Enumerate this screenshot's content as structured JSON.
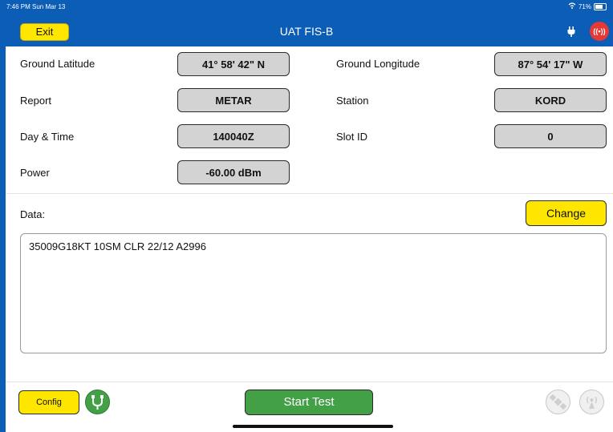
{
  "status_bar": {
    "time": "7:46 PM  Sun Mar 13",
    "battery": "71%"
  },
  "header": {
    "exit_label": "Exit",
    "title": "UAT FIS-B"
  },
  "fields": {
    "ground_latitude_label": "Ground Latitude",
    "ground_latitude_value": "41° 58' 42\" N",
    "ground_longitude_label": "Ground Longitude",
    "ground_longitude_value": "87° 54' 17\" W",
    "report_label": "Report",
    "report_value": "METAR",
    "station_label": "Station",
    "station_value": "KORD",
    "day_time_label": "Day & Time",
    "day_time_value": "140040Z",
    "slot_id_label": "Slot ID",
    "slot_id_value": "0",
    "power_label": "Power",
    "power_value": "-60.00 dBm"
  },
  "data_section": {
    "label": "Data:",
    "change_label": "Change",
    "text": "35009G18KT 10SM CLR 22/12 A2996"
  },
  "footer": {
    "config_label": "Config",
    "start_label": "Start Test"
  },
  "icons": {
    "plug": "plug-icon",
    "signal": "signal-broadcast-icon",
    "connector": "connector-icon",
    "satellite": "satellite-icon",
    "antenna": "antenna-icon"
  },
  "colors": {
    "header": "#0b5db5",
    "yellow_button": "#ffe600",
    "green_button": "#43a047",
    "alert": "#e53935"
  }
}
